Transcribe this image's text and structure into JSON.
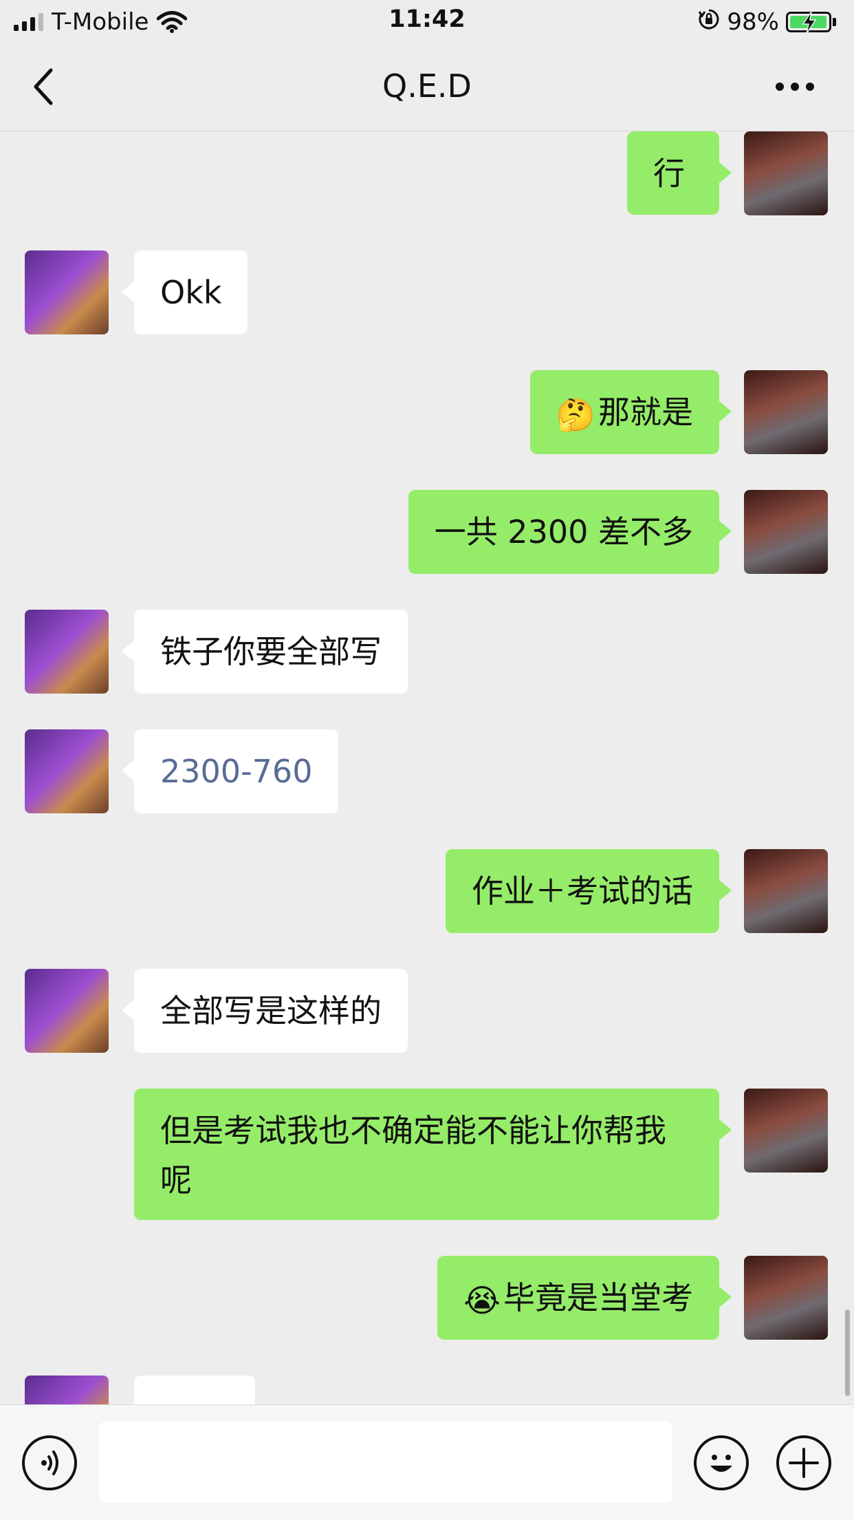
{
  "status_bar": {
    "carrier": "T-Mobile",
    "time": "11:42",
    "battery_percent": "98%",
    "battery_level": 0.98
  },
  "header": {
    "title": "Q.E.D",
    "back_icon": "chevron-left-icon",
    "more_icon": "more-dots-icon"
  },
  "messages": [
    {
      "from": "me",
      "text": "行"
    },
    {
      "from": "them",
      "text": "Okk"
    },
    {
      "from": "me",
      "emoji": "🤔",
      "text": "那就是"
    },
    {
      "from": "me",
      "text": "一共 2300 差不多"
    },
    {
      "from": "them",
      "text": "铁子你要全部写"
    },
    {
      "from": "them",
      "text": "2300-760",
      "link": true
    },
    {
      "from": "me",
      "text": "作业＋考试的话"
    },
    {
      "from": "them",
      "text": "全部写是这样的"
    },
    {
      "from": "me",
      "text": "但是考试我也不确定能不能让你帮我呢"
    },
    {
      "from": "me",
      "emoji": "😭",
      "text": "毕竟是当堂考"
    }
  ],
  "input_bar": {
    "voice_icon": "voice-icon",
    "emoji_icon": "emoji-icon",
    "plus_icon": "plus-icon",
    "message_value": ""
  },
  "colors": {
    "background": "#ededed",
    "my_bubble": "#95ec69",
    "their_bubble": "#ffffff",
    "link_text": "#576b95"
  }
}
